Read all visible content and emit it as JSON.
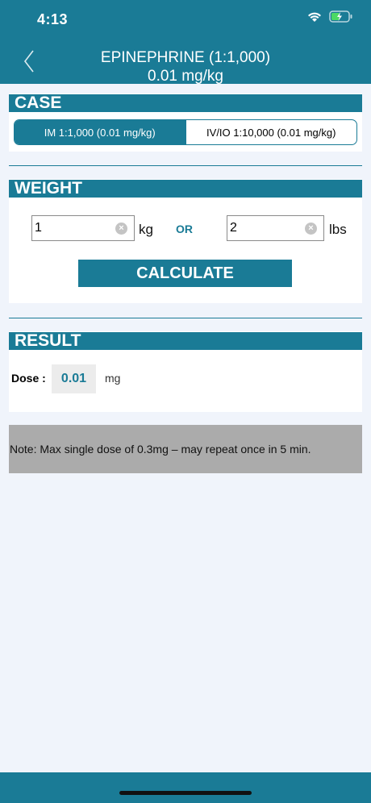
{
  "status": {
    "time": "4:13"
  },
  "nav": {
    "title_line1": "EPINEPHRINE (1:1,000)",
    "title_line2": "0.01 mg/kg"
  },
  "case": {
    "header": "CASE",
    "options": [
      "IM 1:1,000 (0.01 mg/kg)",
      "IV/IO 1:10,000 (0.01 mg/kg)"
    ],
    "selected": "IM 1:1,000 (0.01 mg/kg)"
  },
  "weight": {
    "header": "WEIGHT",
    "kg_value": "1",
    "kg_unit": "kg",
    "or_label": "OR",
    "lbs_value": "2",
    "lbs_unit": "lbs",
    "calculate_label": "CALCULATE"
  },
  "result": {
    "header": "RESULT",
    "dose_label": "Dose :",
    "dose_value": "0.01",
    "dose_unit": "mg"
  },
  "note": "Note: Max single dose of 0.3mg – may repeat once in 5 min.",
  "colors": {
    "primary": "#1a7b96",
    "background": "#f0f4fb",
    "note_bg": "#ababab"
  },
  "icons": [
    "wifi-icon",
    "battery-charging-icon",
    "back-chevron-icon",
    "clear-icon"
  ]
}
